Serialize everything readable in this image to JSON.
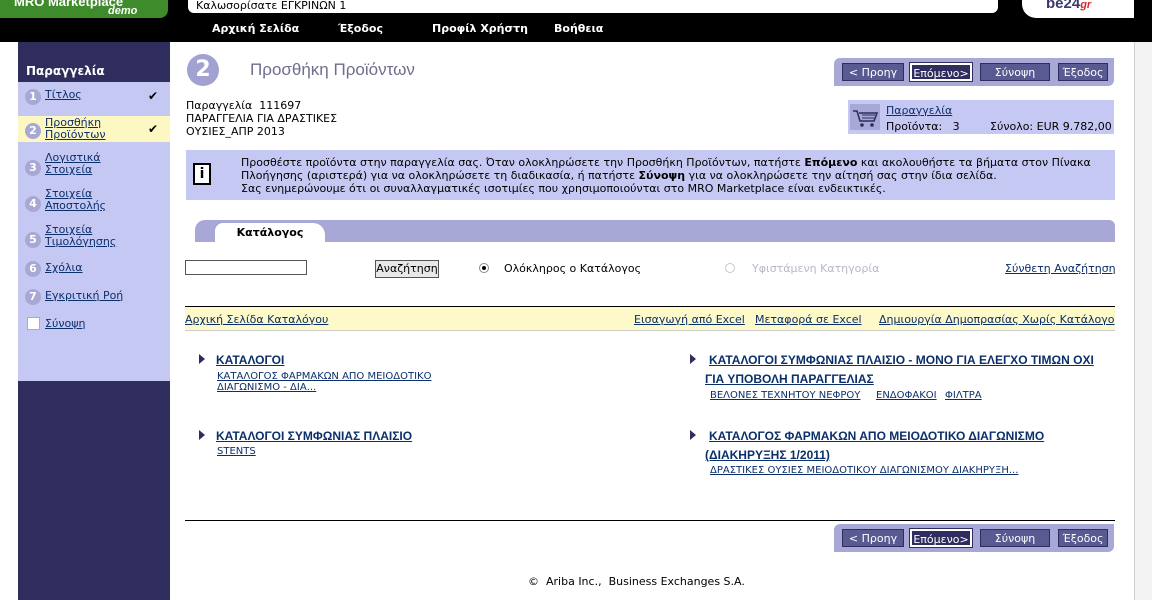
{
  "header": {
    "logo_title": "MRO Marketplace",
    "logo_sub": "demo",
    "welcome": "Καλωσορίσατε ΕΓΚΡΙΝΩΝ 1",
    "brand": "be24",
    "brand_suffix": "gr"
  },
  "nav": {
    "home": "Αρχική Σελίδα",
    "exit": "Έξοδος",
    "profile": "Προφίλ Χρήστη",
    "help": "Βοήθεια"
  },
  "sidebar": {
    "title": "Παραγγελία",
    "steps": [
      {
        "num": "1",
        "label": "Τίτλος",
        "checked": true
      },
      {
        "num": "2",
        "label": "Προσθήκη Προϊόντων",
        "checked": true
      },
      {
        "num": "3",
        "label": "Λογιστικά Στοιχεία"
      },
      {
        "num": "4",
        "label": "Στοιχεία Αποστολής"
      },
      {
        "num": "5",
        "label": "Στοιχεία Τιμολόγησης"
      },
      {
        "num": "6",
        "label": "Σχόλια"
      },
      {
        "num": "7",
        "label": "Εγκριτική Ροή"
      },
      {
        "label": "Σύνοψη"
      }
    ]
  },
  "page": {
    "step_number": "2",
    "title": "Προσθήκη Προϊόντων"
  },
  "toolbar": {
    "prev": "< Προηγ",
    "next": "Επόμενο>",
    "summary": "Σύνοψη",
    "exit": "Έξοδος"
  },
  "order": {
    "line1": "Παραγγελία  111697",
    "line2": "ΠΑΡΑΓΓΕΛΙΑ ΓΙΑ ΔΡΑΣΤΙΚΕΣ",
    "line3": "ΟΥΣΙΕΣ_ΑΠΡ 2013"
  },
  "cart": {
    "title": "Παραγγελία",
    "products": "Προϊόντα:   3",
    "total": "Σύνολο: EUR 9.782,00"
  },
  "info": {
    "text_a": "Προσθέστε προϊόντα στην παραγγελία σας. Όταν ολοκληρώσετε την Προσθήκη Προϊόντων, πατήστε ",
    "bold_next": "Επόμενο",
    "text_b": " και ακολουθήστε τα βήματα στον Πίνακα Πλοήγησης (αριστερά) για να ολοκληρώσετε τη διαδικασία, ή πατήστε ",
    "bold_summary": "Σύνοψη",
    "text_c": " για να ολοκληρώσετε την αίτησή σας στην ίδια σελίδα.",
    "text_d": "Σας ενημερώνουμε ότι οι συναλλαγματικές ισοτιμίες που χρησιμοποιούνται στο MRO Marketplace είναι ενδεικτικές."
  },
  "tabs": {
    "catalog": "Κατάλογος"
  },
  "search": {
    "value": "",
    "button": "Αναζήτηση",
    "radio_all": "Ολόκληρος ο Κατάλογος",
    "radio_category": "Υφιστάμενη Κατηγορία",
    "advanced": "Σύνθετη Αναζήτηση"
  },
  "links_bar": {
    "catalog_home": "Αρχική Σελίδα Καταλόγου",
    "import_excel": "Εισαγωγή από Excel",
    "export_excel": "Μεταφορά σε Excel",
    "create_auction": "Δημιουργία Δημοπρασίας Χωρίς Κατάλογο"
  },
  "catalogs": {
    "c1_title": "ΚΑΤΑΛΟΓΟΙ",
    "c1_sub": "ΚΑΤΑΛΟΓΟΣ ΦΑΡΜΑΚΩΝ ΑΠΟ ΜΕΙΟΔΟΤΙΚΟ ΔΙΑΓΩΝΙΣΜΟ - ΔΙΑ...",
    "c2_title": "ΚΑΤΑΛΟΓΟΙ ΣΥΜΦΩΝΙΑΣ ΠΛΑΙΣΙΟ",
    "c2_sub": "STENTS",
    "c3_title": "ΚΑΤΑΛΟΓΟΙ ΣΥΜΦΩΝΙΑΣ ΠΛΑΙΣΙΟ - ΜΟΝΟ ΓΙΑ ΕΛΕΓΧΟ ΤΙΜΩΝ ΟΧΙ ΓΙΑ ΥΠΟΒΟΛΗ ΠΑΡΑΓΓΕΛΙΑΣ",
    "c3_sub1": "ΒΕΛΟΝΕΣ ΤΕΧΝΗΤΟΥ ΝΕΦΡΟΥ",
    "c3_sub2": "ΕΝΔΟΦΑΚΟΙ",
    "c3_sub3": "ΦΙΛΤΡΑ",
    "c4_title": "ΚΑΤΑΛΟΓΟΣ ΦΑΡΜΑΚΩΝ ΑΠΟ ΜΕΙΟΔΟΤΙΚΟ ΔΙΑΓΩΝΙΣΜΟ (ΔΙΑΚΗΡΥΞΗΣ 1/2011)",
    "c4_sub": "ΔΡΑΣΤΙΚΕΣ ΟΥΣΙΕΣ ΜΕΙΟΔΟΤΙΚΟΥ ΔΙΑΓΩΝΙΣΜΟΥ ΔΙΑΚΗΡΥΞΗ..."
  },
  "footer": {
    "copyright": "©  Ariba Inc.,  Business Exchanges S.A."
  }
}
